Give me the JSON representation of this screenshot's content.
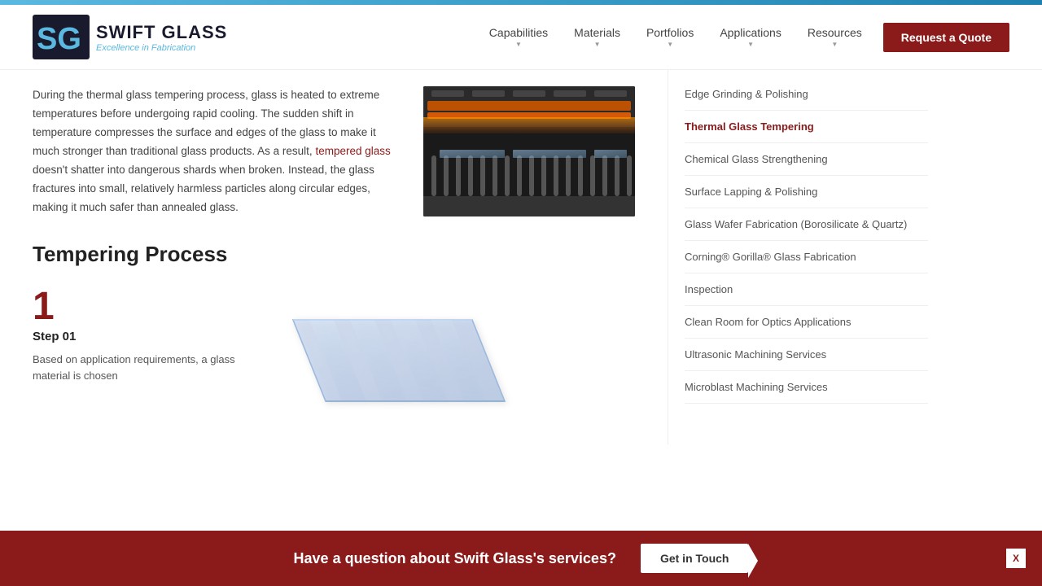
{
  "topBar": {
    "color": "#5bb8e0"
  },
  "header": {
    "logo": {
      "sg_text": "SG",
      "company_name": "SWIFT GLASS",
      "tagline": "Excellence in Fabrication"
    },
    "nav": {
      "items": [
        {
          "label": "Capabilities",
          "id": "capabilities"
        },
        {
          "label": "Materials",
          "id": "materials"
        },
        {
          "label": "Portfolios",
          "id": "portfolios"
        },
        {
          "label": "Applications",
          "id": "applications"
        },
        {
          "label": "Resources",
          "id": "resources"
        }
      ],
      "cta_label": "Request a Quote"
    }
  },
  "main": {
    "intro_paragraph_1": "During the thermal glass tempering process, glass is heated to extreme temperatures before undergoing rapid cooling. The sudden shift in temperature compresses the surface and edges of the glass to make it much stronger than traditional glass products. As a result,",
    "intro_link": "tempered glass",
    "intro_paragraph_2": "doesn't shatter into dangerous shards when broken. Instead, the glass fractures into small, relatively harmless particles along circular edges, making it much safer than annealed glass.",
    "section_title": "Tempering Process",
    "step_number": "1",
    "step_label": "Step 01",
    "step_description": "Based on application requirements, a glass material is chosen"
  },
  "sidebar": {
    "links": [
      {
        "label": "Edge Grinding & Polishing",
        "active": false,
        "id": "edge-grinding"
      },
      {
        "label": "Thermal Glass Tempering",
        "active": true,
        "id": "thermal-glass"
      },
      {
        "label": "Chemical Glass Strengthening",
        "active": false,
        "id": "chemical-glass"
      },
      {
        "label": "Surface Lapping & Polishing",
        "active": false,
        "id": "surface-lapping"
      },
      {
        "label": "Glass Wafer Fabrication (Borosilicate & Quartz)",
        "active": false,
        "id": "glass-wafer"
      },
      {
        "label": "Corning® Gorilla® Glass Fabrication",
        "active": false,
        "id": "corning"
      },
      {
        "label": "Inspection",
        "active": false,
        "id": "inspection"
      },
      {
        "label": "Clean Room for Optics Applications",
        "active": false,
        "id": "clean-room"
      },
      {
        "label": "Ultrasonic Machining Services",
        "active": false,
        "id": "ultrasonic"
      },
      {
        "label": "Microblast Machining Services",
        "active": false,
        "id": "microblast"
      }
    ]
  },
  "cta_bar": {
    "text": "Have a question about Swift Glass's services?",
    "button_label": "Get in Touch",
    "close_label": "X"
  }
}
